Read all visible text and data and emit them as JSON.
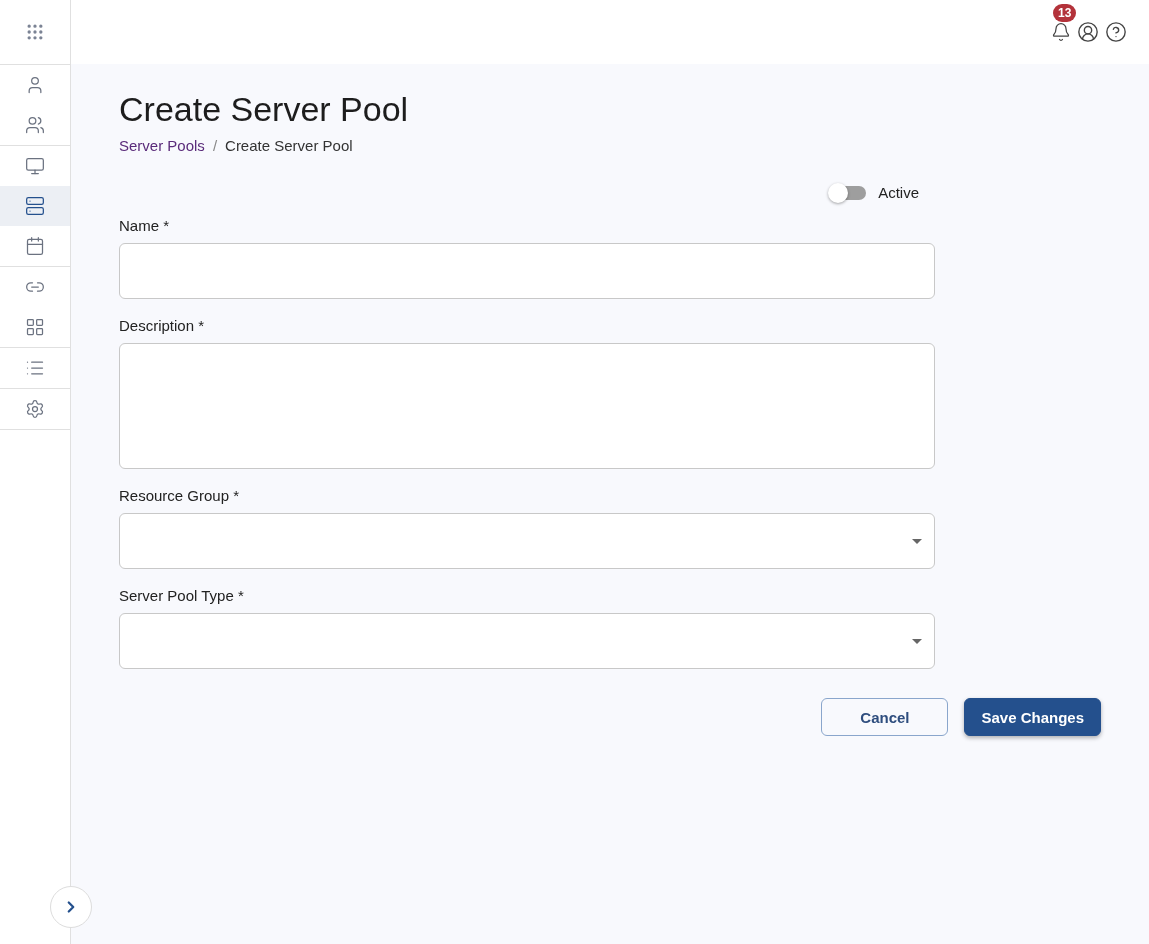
{
  "sidebar": {
    "groups": [
      {
        "items": [
          {
            "selected": false
          },
          {
            "selected": false
          }
        ]
      },
      {
        "items": [
          {
            "selected": false
          },
          {
            "selected": true
          },
          {
            "selected": false
          }
        ]
      },
      {
        "items": [
          {
            "selected": false
          },
          {
            "selected": false
          }
        ]
      },
      {
        "items": [
          {
            "selected": false
          }
        ]
      },
      {
        "items": [
          {
            "selected": false
          }
        ]
      }
    ]
  },
  "header": {
    "notification_count": "13"
  },
  "page": {
    "title": "Create Server Pool",
    "breadcrumb": {
      "separator": "/",
      "items": [
        "Server Pools",
        "Create Server Pool"
      ]
    }
  },
  "form": {
    "active_toggle": {
      "label": "Active",
      "on": false
    },
    "fields": [
      {
        "kind": "text",
        "label": "Name *"
      },
      {
        "kind": "textarea",
        "label": "Description *"
      },
      {
        "kind": "select",
        "label": "Resource Group *"
      },
      {
        "kind": "select",
        "label": "Server Pool Type *"
      }
    ],
    "buttons": [
      {
        "kind": "secondary",
        "label": "Cancel"
      },
      {
        "kind": "primary",
        "label": "Save Changes"
      }
    ]
  }
}
